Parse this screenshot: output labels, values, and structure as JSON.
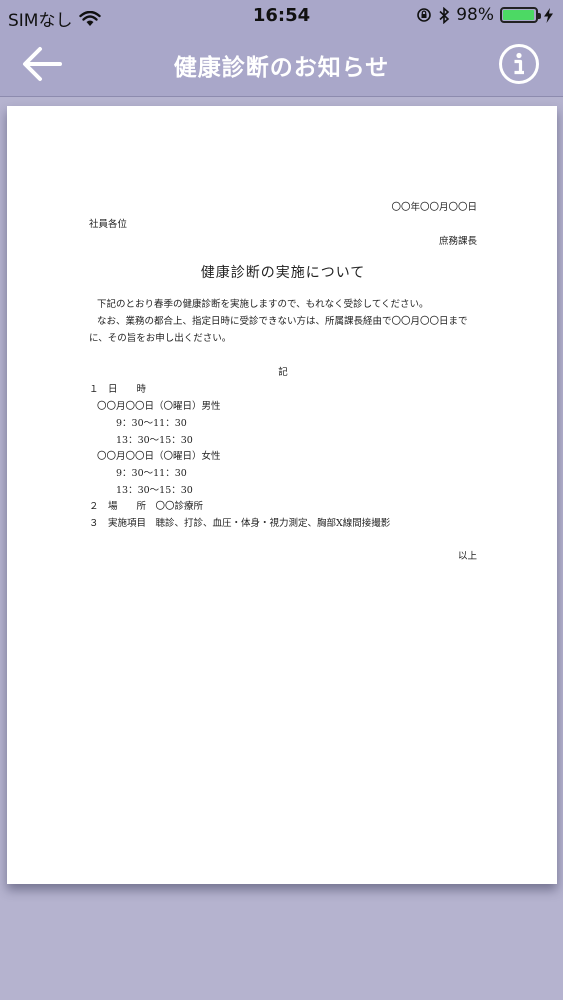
{
  "status_bar": {
    "carrier": "SIMなし",
    "time": "16:54",
    "battery": "98%",
    "battery_level": 0.98
  },
  "nav": {
    "title": "健康診断のお知らせ",
    "back_icon": "arrow-left-icon",
    "info_icon": "info-circle-icon"
  },
  "document": {
    "date": "〇〇年〇〇月〇〇日",
    "recipient": "社員各位",
    "sender": "庶務課長",
    "title": "健康診断の実施について",
    "body_line1": "下記のとおり春季の健康診断を実施しますので、もれなく受診してください。",
    "body_line2": "なお、業務の都合上、指定日時に受診できない方は、所属課長経由で〇〇月〇〇日まで",
    "body_line3": "に、その旨をお申し出ください。",
    "ki": "記",
    "item1_label": "１　日　　時",
    "item1_male": "〇〇月〇〇日（〇曜日）男性",
    "item1_male_t1": "9：30〜11：30",
    "item1_male_t2": "13：30〜15：30",
    "item1_female": "〇〇月〇〇日（〇曜日）女性",
    "item1_female_t1": "9：30〜11：30",
    "item1_female_t2": "13：30〜15：30",
    "item2": "２　場　　所　〇〇診療所",
    "item3": "３　実施項目　聴診、打診、血圧・体身・視力測定、胸部X線間接撮影",
    "closing": "以上"
  }
}
